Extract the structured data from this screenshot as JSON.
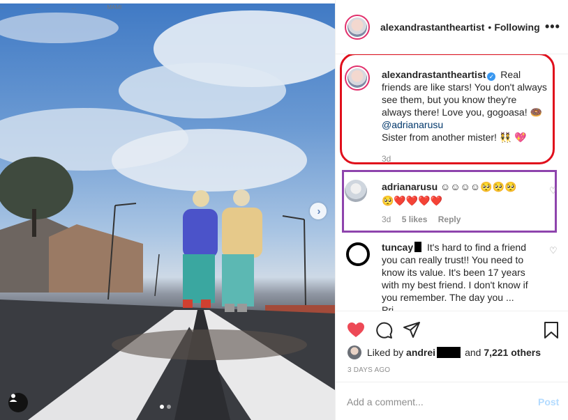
{
  "top_strip": [
    "...",
    "...",
    "...",
    "MAMI"
  ],
  "header": {
    "username": "alexandrastantheartist",
    "separator": "•",
    "following": "Following",
    "more": "•••"
  },
  "caption": {
    "username": "alexandrastantheartist",
    "text1": "Real friends are like stars! You don't always see them, but you know they're always there! Love you, gogoasa! 🍩",
    "mention": "@adrianarusu",
    "text2": "Sister from another mister! 👯 💖",
    "time": "3d"
  },
  "comments": [
    {
      "username": "adrianarusu",
      "text": "☺☺☺☺🥺🥺🥺🥺❤️❤️❤️❤️",
      "time": "3d",
      "likes": "5 likes",
      "reply": "Reply"
    },
    {
      "username": "tuncay",
      "text": "It's hard to find a friend you can really trust!! You need to know its value. It's been 17 years with my best friend. I don't know if you remember. The day you ... Pri..."
    }
  ],
  "likes": {
    "prefix": "Liked by",
    "user": "andrei",
    "conj": "and",
    "others": "7,221 others"
  },
  "date": "3 DAYS AGO",
  "add_comment": {
    "placeholder": "Add a comment...",
    "post": "Post"
  },
  "colors": {
    "like_red": "#ed4956",
    "verified_blue": "#3897f0",
    "mention_blue": "#00376b",
    "post_disabled": "#b3dbff",
    "highlight_red": "#e00f1c",
    "highlight_purple": "#8e44ad"
  }
}
